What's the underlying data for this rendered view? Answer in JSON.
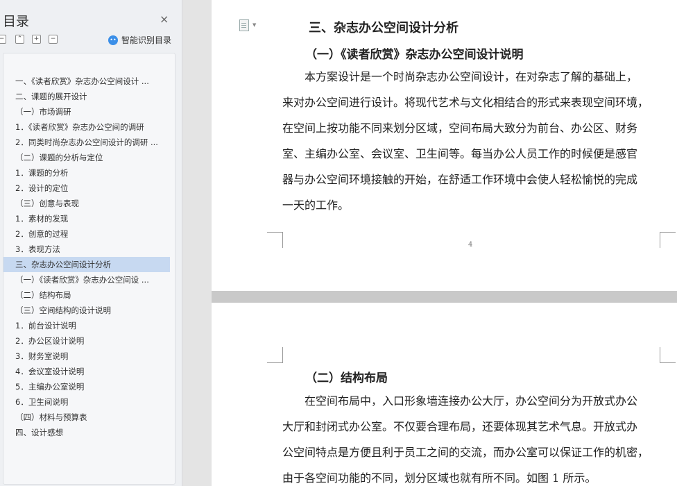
{
  "toc": {
    "title": "目录",
    "close_icon": "×",
    "smart_label": "智能识别目录",
    "tools": [
      "−",
      "⌃",
      "+",
      "−"
    ],
    "items": [
      {
        "label": "一、《读者欣赏》杂志办公空间设计 ...",
        "active": false
      },
      {
        "label": "二、课题的展开设计",
        "active": false
      },
      {
        "label": "（一）市场调研",
        "active": false
      },
      {
        "label": "1．《读者欣赏》杂志办公空间的调研",
        "active": false
      },
      {
        "label": "2．同类时尚杂志办公空间设计的调研 ...",
        "active": false
      },
      {
        "label": "（二）课题的分析与定位",
        "active": false
      },
      {
        "label": "1．课题的分析",
        "active": false
      },
      {
        "label": "2．设计的定位",
        "active": false
      },
      {
        "label": "（三）创意与表现",
        "active": false
      },
      {
        "label": "1．素材的发现",
        "active": false
      },
      {
        "label": "2．创意的过程",
        "active": false
      },
      {
        "label": "3．表现方法",
        "active": false
      },
      {
        "label": "三、杂志办公空间设计分析",
        "active": true
      },
      {
        "label": "（一）《读者欣赏》杂志办公空间设 ...",
        "active": false
      },
      {
        "label": "（二）结构布局",
        "active": false
      },
      {
        "label": "（三）空间结构的设计说明",
        "active": false
      },
      {
        "label": "1．前台设计说明",
        "active": false
      },
      {
        "label": "2．办公区设计说明",
        "active": false
      },
      {
        "label": "3．财务室说明",
        "active": false
      },
      {
        "label": "4．会议室设计说明",
        "active": false
      },
      {
        "label": "5．主编办公室说明",
        "active": false
      },
      {
        "label": "6．卫生间说明",
        "active": false
      },
      {
        "label": "（四）材料与预算表",
        "active": false
      },
      {
        "label": "四、设计感想",
        "active": false
      }
    ]
  },
  "document": {
    "page1": {
      "heading": "三、杂志办公空间设计分析",
      "subheading": "（一）《读者欣赏》杂志办公空间设计说明",
      "lines": [
        "　　本方案设计是一个时尚杂志办公空间设计，在对杂志了解的基础上，",
        "来对办公空间进行设计。将现代艺术与文化相结合的形式来表现空间环境，",
        "在空间上按功能不同来划分区域，空间布局大致分为前台、办公区、财务",
        "室、主编办公室、会议室、卫生间等。每当办公人员工作的时候便是感官",
        "器与办公空间环境接触的开始，在舒适工作环境中会使人轻松愉悦的完成",
        "一天的工作。"
      ],
      "page_number": "4"
    },
    "page2": {
      "subheading": "（二）结构布局",
      "lines": [
        "　　在空间布局中，入口形象墙连接办公大厅，办公空间分为开放式办公",
        "大厅和封闭式办公室。不仅要合理布局，还要体现其艺术气息。开放式办",
        "公空间特点是方便且利于员工之间的交流，而办公室可以保证工作的机密，",
        "由于各空间功能的不同，划分区域也就有所不同。如图 1 所示。"
      ]
    }
  }
}
